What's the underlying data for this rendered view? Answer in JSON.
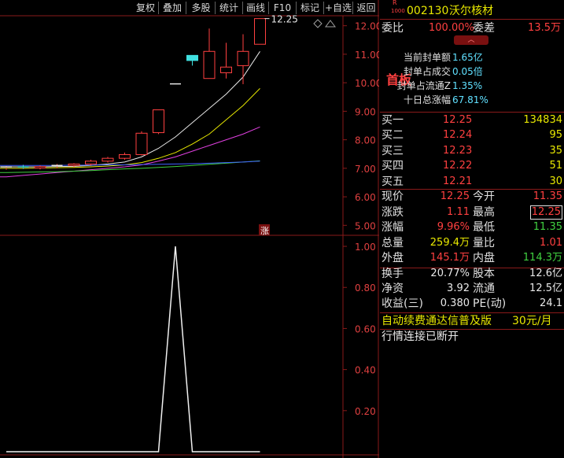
{
  "toolbar": {
    "buttons": [
      "复权",
      "叠加",
      "多股",
      "统计",
      "画线",
      "F10",
      "标记",
      "+自选",
      "返回"
    ]
  },
  "stock": {
    "badge_top": "R",
    "badge_bottom": "1000",
    "code": "002130",
    "name": "沃尔核材"
  },
  "chart_data": [
    {
      "type": "candlestick",
      "y_ticks": [
        "12.00",
        "11.00",
        "10.00",
        "9.00",
        "8.00",
        "7.00",
        "6.00",
        "5.00"
      ],
      "ylim": [
        4.65,
        12.35
      ],
      "last_price_label": "12.25",
      "limit_up_marker": "涨",
      "candles": [
        {
          "o": 7.02,
          "h": 7.08,
          "l": 6.95,
          "c": 7.05
        },
        {
          "o": 7.05,
          "h": 7.12,
          "l": 6.98,
          "c": 7.02
        },
        {
          "o": 7.01,
          "h": 7.1,
          "l": 6.96,
          "c": 7.06
        },
        {
          "o": 7.06,
          "h": 7.15,
          "l": 7.0,
          "c": 7.1
        },
        {
          "o": 7.1,
          "h": 7.18,
          "l": 7.04,
          "c": 7.15
        },
        {
          "o": 7.15,
          "h": 7.3,
          "l": 7.1,
          "c": 7.25
        },
        {
          "o": 7.25,
          "h": 7.4,
          "l": 7.2,
          "c": 7.35
        },
        {
          "o": 7.35,
          "h": 7.55,
          "l": 7.3,
          "c": 7.48
        },
        {
          "o": 7.48,
          "h": 8.3,
          "l": 7.45,
          "c": 8.23
        },
        {
          "o": 8.25,
          "h": 9.05,
          "l": 8.2,
          "c": 9.05
        },
        {
          "o": 9.96,
          "h": 9.96,
          "l": 9.96,
          "c": 9.96
        },
        {
          "o": 10.96,
          "h": 10.96,
          "l": 10.6,
          "c": 10.78
        },
        {
          "o": 10.15,
          "h": 11.9,
          "l": 10.15,
          "c": 11.1
        },
        {
          "o": 10.35,
          "h": 11.4,
          "l": 10.15,
          "c": 10.55
        },
        {
          "o": 10.6,
          "h": 11.7,
          "l": 9.95,
          "c": 11.1
        },
        {
          "o": 11.35,
          "h": 12.25,
          "l": 11.35,
          "c": 12.25
        }
      ],
      "ma_series": [
        {
          "color": "#e8e8e8",
          "values": [
            7.05,
            7.05,
            7.05,
            7.06,
            7.07,
            7.1,
            7.15,
            7.22,
            7.4,
            7.7,
            8.1,
            8.6,
            9.1,
            9.6,
            10.2,
            11.1
          ]
        },
        {
          "color": "#e8e800",
          "values": [
            7.0,
            7.0,
            7.01,
            7.02,
            7.03,
            7.05,
            7.08,
            7.12,
            7.2,
            7.35,
            7.55,
            7.85,
            8.2,
            8.7,
            9.2,
            9.8
          ]
        },
        {
          "color": "#e040e0",
          "values": [
            6.7,
            6.75,
            6.8,
            6.85,
            6.9,
            6.95,
            7.0,
            7.05,
            7.12,
            7.25,
            7.4,
            7.6,
            7.8,
            8.0,
            8.2,
            8.45
          ]
        },
        {
          "color": "#40d040",
          "values": [
            6.85,
            6.86,
            6.87,
            6.88,
            6.9,
            6.92,
            6.95,
            6.98,
            7.0,
            7.03,
            7.06,
            7.1,
            7.14,
            7.18,
            7.22,
            7.26
          ]
        },
        {
          "color": "#4060ff",
          "values": [
            7.1,
            7.1,
            7.1,
            7.1,
            7.11,
            7.11,
            7.12,
            7.12,
            7.13,
            7.14,
            7.15,
            7.16,
            7.18,
            7.2,
            7.22,
            7.25
          ]
        }
      ]
    },
    {
      "type": "line",
      "y_ticks": [
        "1.00",
        "0.80",
        "0.60",
        "0.40",
        "0.20"
      ],
      "ylim": [
        0,
        1.05
      ],
      "values": [
        0,
        0,
        0,
        0,
        0,
        0,
        0,
        0,
        0,
        0,
        1,
        0,
        0,
        0,
        0,
        0
      ]
    }
  ],
  "panel": {
    "weibi_label": "委比",
    "weibi_value": "100.00%",
    "weicha_label": "委差",
    "weicha_value": "13.5万",
    "shouban_label": "首板",
    "info": [
      {
        "label": "当前封单额",
        "value": "1.65亿"
      },
      {
        "label": "封单占成交",
        "value": "0.05倍"
      },
      {
        "label": "封单占流通Z",
        "value": "1.35%"
      },
      {
        "label": "十日总涨幅",
        "value": "67.81%"
      }
    ],
    "bids": [
      {
        "label": "买一",
        "price": "12.25",
        "vol": "134834"
      },
      {
        "label": "买二",
        "price": "12.24",
        "vol": "95"
      },
      {
        "label": "买三",
        "price": "12.23",
        "vol": "35"
      },
      {
        "label": "买四",
        "price": "12.22",
        "vol": "51"
      },
      {
        "label": "买五",
        "price": "12.21",
        "vol": "30"
      }
    ],
    "quote": [
      {
        "l1": "现价",
        "v1": "12.25",
        "l2": "今开",
        "v2": "11.35"
      },
      {
        "l1": "涨跌",
        "v1": "1.11",
        "l2": "最高",
        "v2": "12.25"
      },
      {
        "l1": "涨幅",
        "v1": "9.96%",
        "l2": "最低",
        "v2": "11.35"
      },
      {
        "l1": "总量",
        "v1": "259.4万",
        "l2": "量比",
        "v2": "1.01"
      },
      {
        "l1": "外盘",
        "v1": "145.1万",
        "l2": "内盘",
        "v2": "114.3万"
      }
    ],
    "fund": [
      {
        "l1": "换手",
        "v1": "20.77%",
        "l2": "股本",
        "v2": "12.6亿"
      },
      {
        "l1": "净资",
        "v1": "3.92",
        "l2": "流通",
        "v2": "12.5亿"
      },
      {
        "l1": "收益(三)",
        "v1": "0.380",
        "l2": "PE(动)",
        "v2": "24.1"
      }
    ],
    "ad_text": "自动续费通达信普及版",
    "ad_price": "30元/月",
    "status": "行情连接已断开"
  },
  "colors": {
    "up": "#ff4040",
    "down": "#40e0e0",
    "grid": "#8a1a1a",
    "axis_text": "#e04040"
  }
}
